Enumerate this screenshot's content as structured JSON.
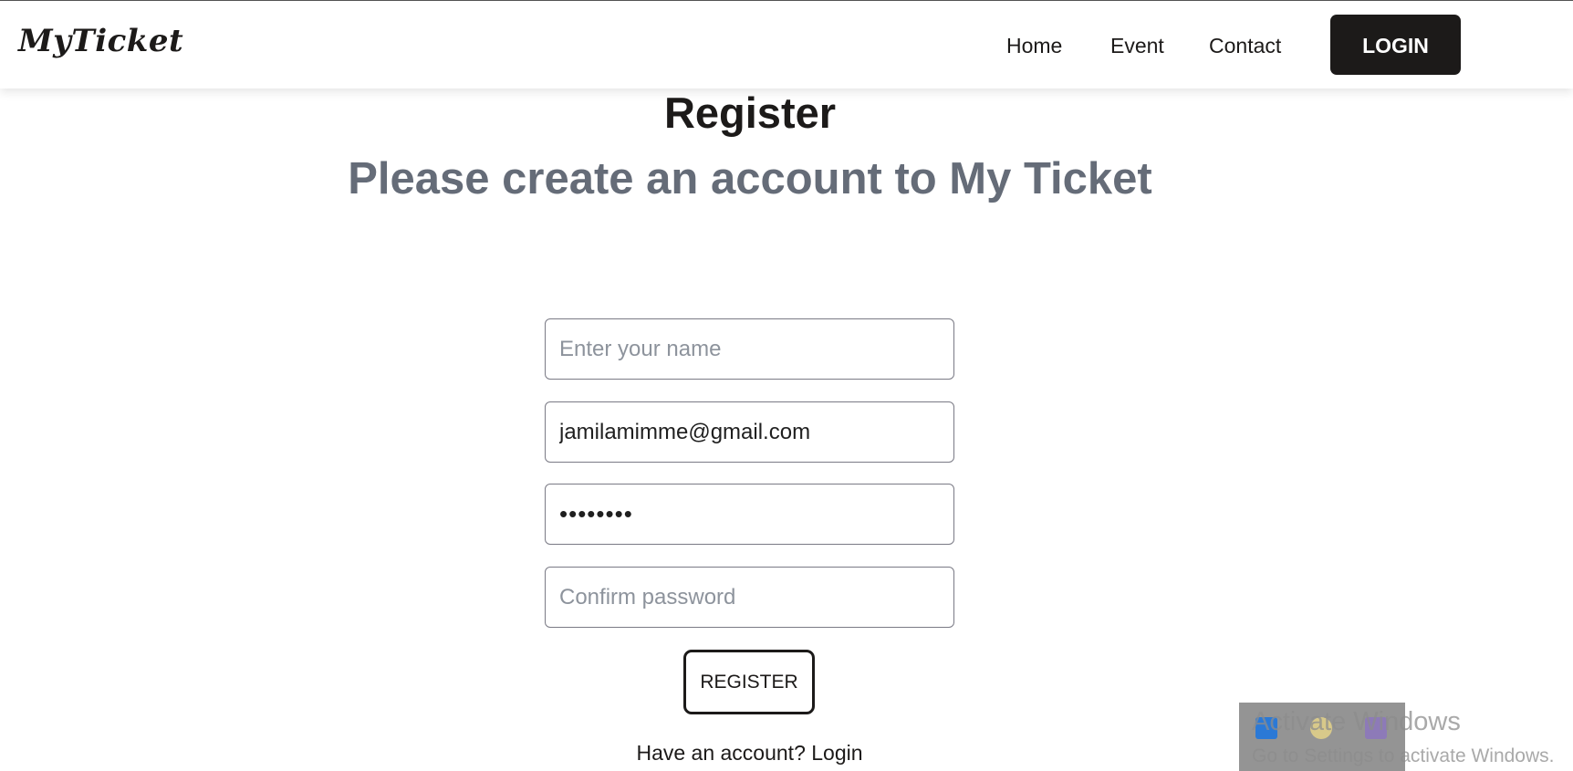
{
  "navbar": {
    "brand": "MyTicket",
    "links": {
      "home": "Home",
      "event": "Event",
      "contact": "Contact"
    },
    "login_label": "LOGIN"
  },
  "page": {
    "title": "Register",
    "subtitle": "Please create an account to My Ticket"
  },
  "form": {
    "name": {
      "value": "",
      "placeholder": "Enter your name"
    },
    "email": {
      "value": "jamilamimme@gmail.com",
      "placeholder": ""
    },
    "password": {
      "value": "12345678",
      "placeholder": ""
    },
    "confirm": {
      "value": "",
      "placeholder": "Confirm password"
    },
    "submit_label": "REGISTER"
  },
  "footer": {
    "prompt": "Have an account?",
    "login_link": "Login"
  },
  "os_overlay": {
    "title": "Activate Windows",
    "subtitle": "Go to Settings to activate Windows."
  },
  "colors": {
    "primary": "#1c1a19",
    "subtitle": "#656c78",
    "placeholder": "#8d939c"
  }
}
